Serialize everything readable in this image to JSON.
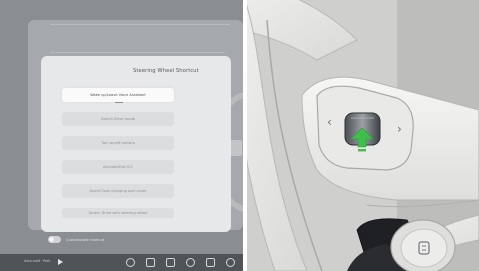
{
  "dialog": {
    "title": "Steering Wheel Shortcut",
    "options": [
      {
        "label": "Wake up/Leave Voice Assistant",
        "selected": true
      },
      {
        "label": "Switch Drive mode",
        "selected": false
      },
      {
        "label": "Turn on/off camera",
        "selected": false
      },
      {
        "label": "Activate/Exit ICC",
        "selected": false
      },
      {
        "label": "Open/Close charging port cover",
        "selected": false
      },
      {
        "label": "Switch Drive with steering wheel",
        "selected": false
      }
    ]
  },
  "toggle": {
    "label": "Customizable shortcut",
    "on": false
  },
  "taskbar": {
    "status": "Auto-hold · Park"
  },
  "wheel": {
    "left_arrow": "‹",
    "right_arrow": "›",
    "accent_color": "#3fbf4c"
  }
}
